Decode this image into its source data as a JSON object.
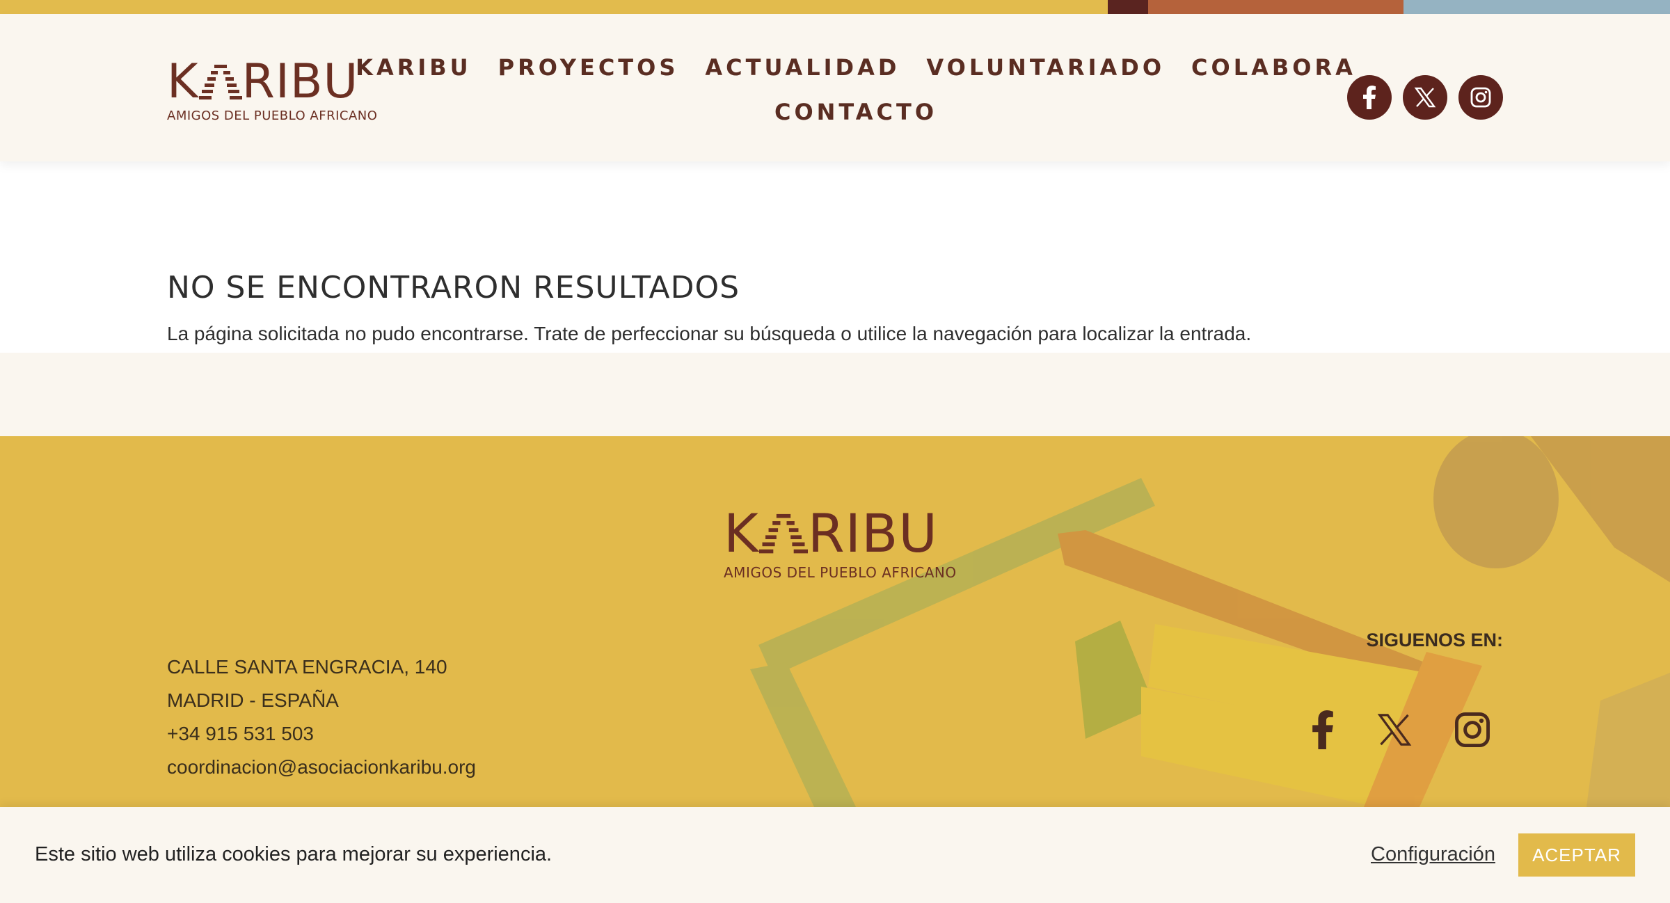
{
  "colors": {
    "topbar": [
      "#e2bb4d",
      "#5a2420",
      "#b5623b",
      "#95b3c2"
    ],
    "brand_brown": "#6b2f22",
    "nav_text": "#5a2d22",
    "footer_yellow": "#e2ba4b",
    "header_bg": "#faf6ef"
  },
  "header": {
    "logo": {
      "word_k": "K",
      "word_rest": "RIBU",
      "tagline": "AMIGOS DEL PUEBLO AFRICANO"
    },
    "nav": {
      "row1": [
        "KARIBU",
        "PROYECTOS",
        "ACTUALIDAD",
        "VOLUNTARIADO",
        "COLABORA"
      ],
      "row2": [
        "CONTACTO"
      ]
    },
    "social_icons": [
      "facebook-icon",
      "x-icon",
      "instagram-icon"
    ]
  },
  "main": {
    "title": "NO SE ENCONTRARON RESULTADOS",
    "message": "La página solicitada no pudo encontrarse. Trate de perfeccionar su búsqueda o utilice la navegación para localizar la entrada."
  },
  "footer": {
    "logo": {
      "word_k": "K",
      "word_rest": "RIBU",
      "tagline": "AMIGOS DEL PUEBLO AFRICANO"
    },
    "address_lines": [
      "CALLE SANTA ENGRACIA, 140",
      "MADRID - ESPAÑA",
      "+34 915 531 503",
      "coordinacion@asociacionkaribu.org"
    ],
    "follow_label": "SIGUENOS EN:",
    "social_icons": [
      "facebook-icon",
      "x-icon",
      "instagram-icon"
    ]
  },
  "cookie_banner": {
    "message": "Este sitio web utiliza cookies para mejorar su experiencia.",
    "config_label": "Configuración",
    "accept_label": "ACEPTAR"
  }
}
